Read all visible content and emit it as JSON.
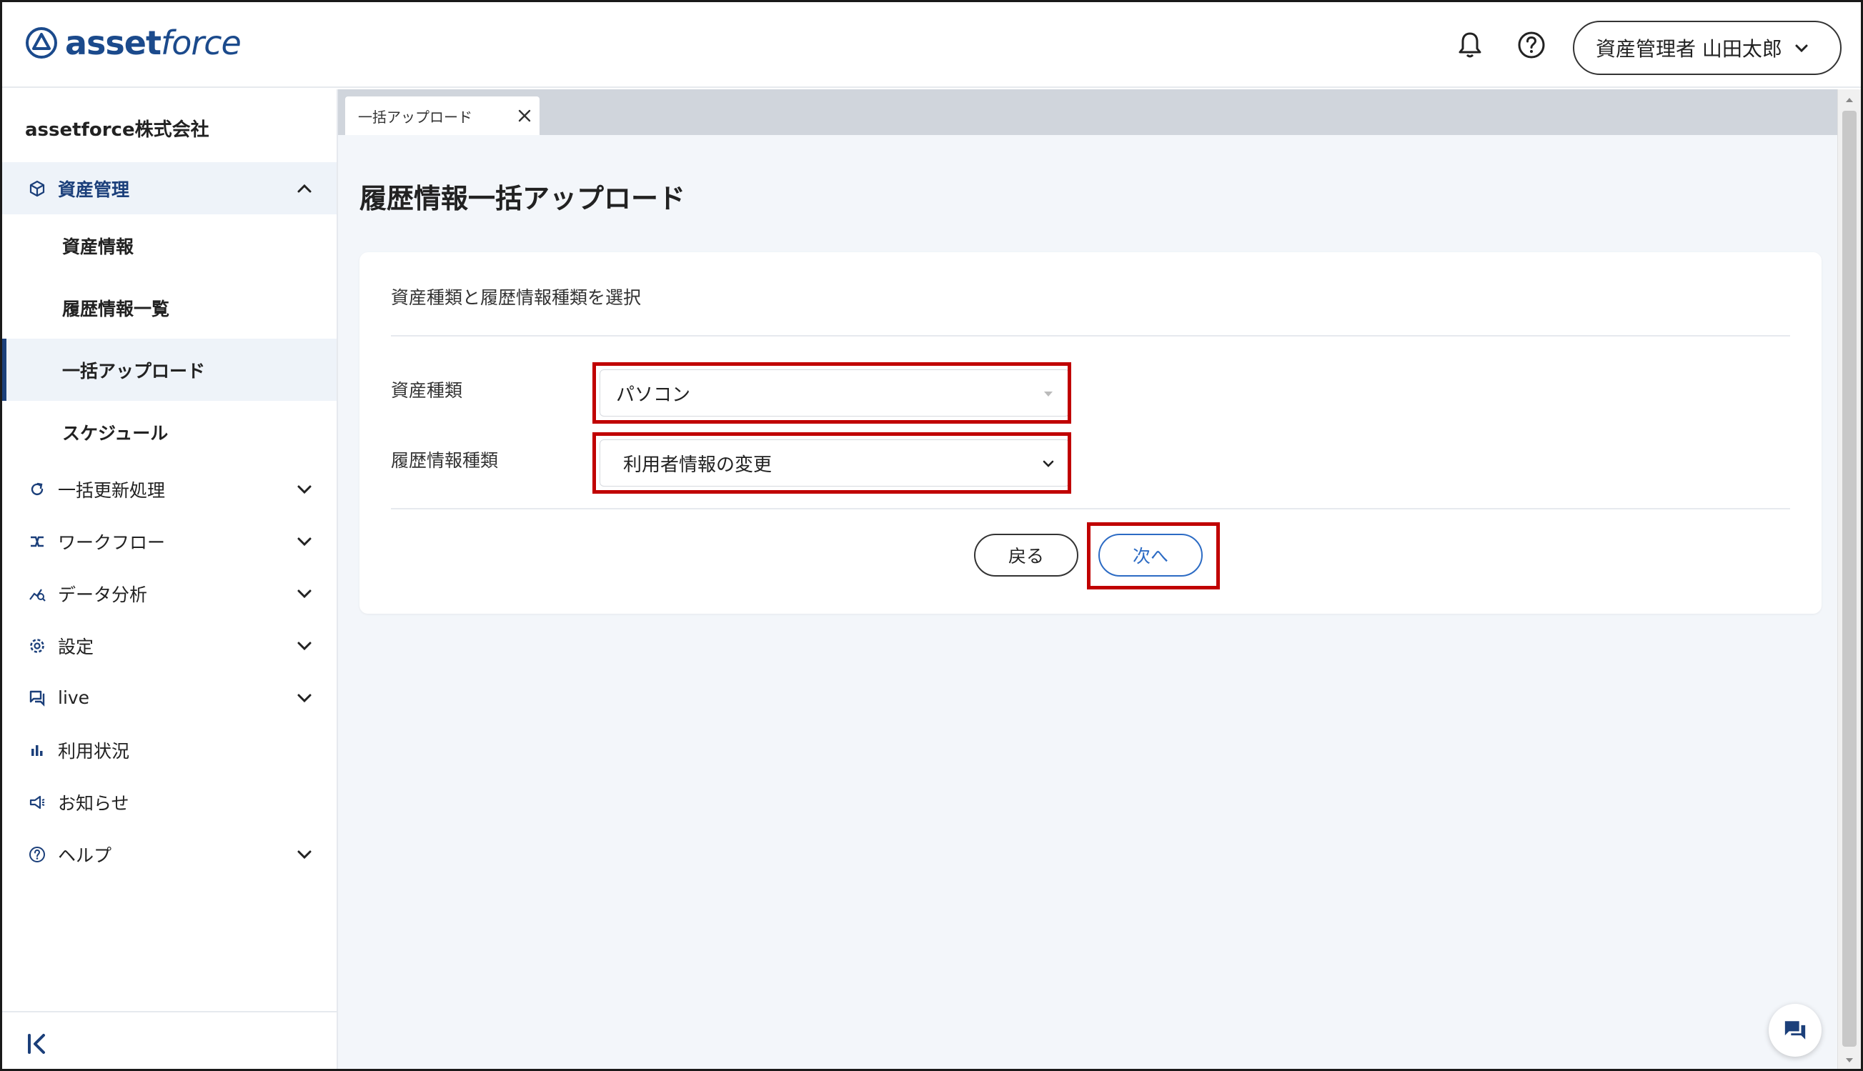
{
  "header": {
    "logo_asset": "asset",
    "logo_force": "force",
    "user_label": "資産管理者 山田太郎",
    "icons": [
      "bell-icon",
      "help-circle-icon",
      "chevron-down-icon"
    ]
  },
  "sidebar": {
    "company": "assetforce株式会社",
    "groups": [
      {
        "label": "資産管理",
        "icon": "cube-icon",
        "expanded": true,
        "children": [
          "資産情報",
          "履歴情報一覧",
          "一括アップロード",
          "スケジュール"
        ],
        "selected_child": "一括アップロード"
      },
      {
        "label": "一括更新処理",
        "icon": "refresh-icon"
      },
      {
        "label": "ワークフロー",
        "icon": "workflow-icon"
      },
      {
        "label": "データ分析",
        "icon": "analytics-icon"
      },
      {
        "label": "設定",
        "icon": "gear-icon"
      },
      {
        "label": "live",
        "icon": "chat-icon"
      },
      {
        "label": "利用状況",
        "icon": "bar-chart-icon"
      },
      {
        "label": "お知らせ",
        "icon": "megaphone-icon"
      },
      {
        "label": "ヘルプ",
        "icon": "help-circle-icon"
      }
    ]
  },
  "tabs": [
    {
      "label": "一括アップロード"
    }
  ],
  "main": {
    "title": "履歴情報一括アップロード",
    "card_heading": "資産種類と履歴情報種類を選択",
    "fields": {
      "asset_type_label": "資産種類",
      "asset_type_value": "パソコン",
      "history_type_label": "履歴情報種類",
      "history_type_value": "利用者情報の変更"
    },
    "buttons": {
      "back": "戻る",
      "next": "次へ"
    }
  },
  "colors": {
    "brand": "#1b4a8c",
    "accent": "#2c6bc4",
    "highlight": "#c00000",
    "selected_bg": "#eef3f9"
  }
}
